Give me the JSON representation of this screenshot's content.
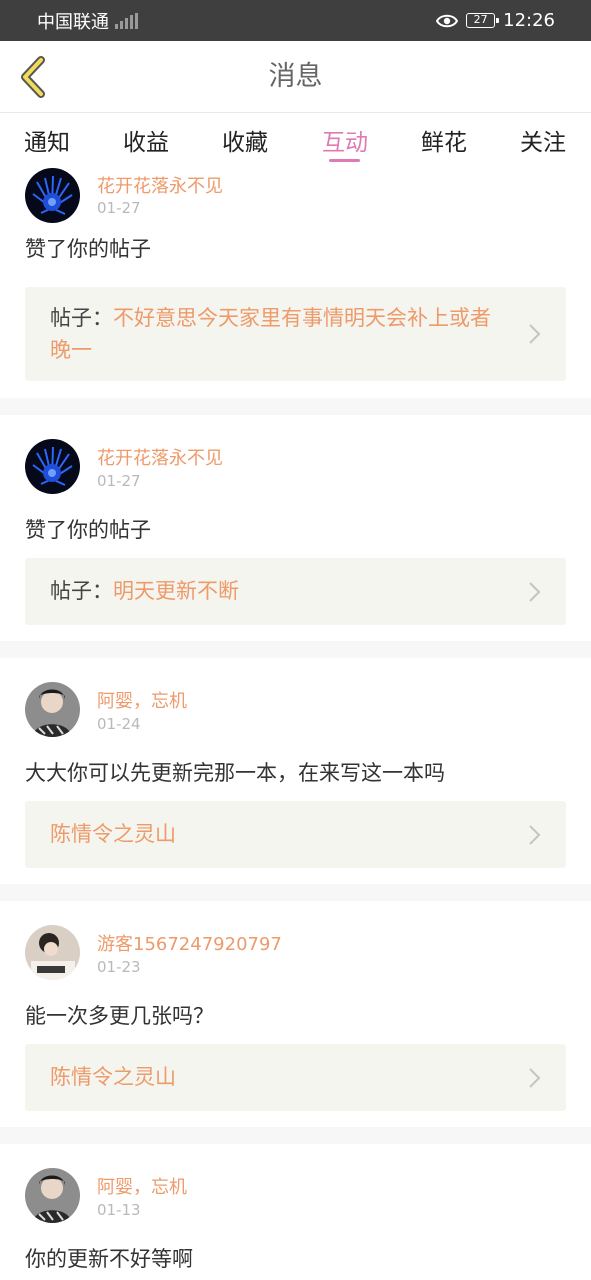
{
  "status_bar": {
    "carrier": "中国联通",
    "battery": "27",
    "time": "12:26"
  },
  "header": {
    "title": "消息",
    "back_icon": "chevron-left-icon"
  },
  "tabs": [
    {
      "label": "通知",
      "active": false
    },
    {
      "label": "收益",
      "active": false
    },
    {
      "label": "收藏",
      "active": false
    },
    {
      "label": "互动",
      "active": true
    },
    {
      "label": "鲜花",
      "active": false
    },
    {
      "label": "关注",
      "active": false
    }
  ],
  "colors": {
    "accent": "#e07ab3",
    "name": "#ee9a6a",
    "ref_bg": "#f5f5ef"
  },
  "messages": [
    {
      "user": "花开花落永不见",
      "date": "01-27",
      "text": "赞了你的帖子",
      "ref_prefix": "帖子：",
      "ref_title": "不好意思今天家里有事情明天会补上或者晚一"
    },
    {
      "user": "花开花落永不见",
      "date": "01-27",
      "text": "赞了你的帖子",
      "ref_prefix": "帖子：",
      "ref_title": "明天更新不断"
    },
    {
      "user": "阿婴，忘机",
      "date": "01-24",
      "text": "大大你可以先更新完那一本，在来写这一本吗",
      "ref_prefix": "",
      "ref_title": "陈情令之灵山"
    },
    {
      "user": "游客1567247920797",
      "date": "01-23",
      "text": "能一次多更几张吗？",
      "ref_prefix": "",
      "ref_title": "陈情令之灵山"
    },
    {
      "user": "阿婴，忘机",
      "date": "01-13",
      "text": "你的更新不好等啊"
    }
  ]
}
